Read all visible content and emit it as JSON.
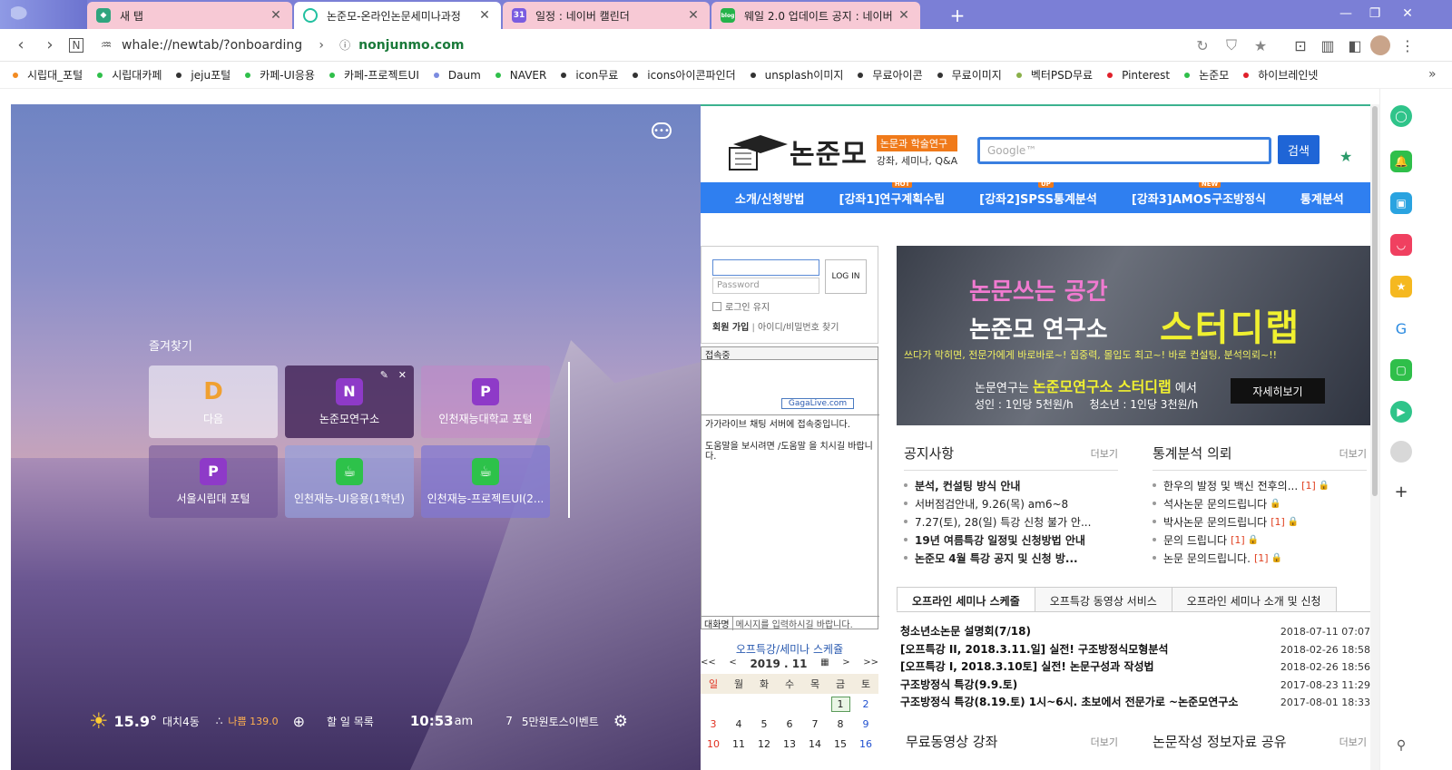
{
  "tabs": [
    {
      "title": "새 탭",
      "icon_color": "#2fa57e"
    },
    {
      "title": "논준모-온라인논문세미나과정",
      "icon_color": "#22c0a0"
    },
    {
      "title": "일정 : 네이버 캘린더",
      "icon_color": "#7a5ce0",
      "icon_text": "31"
    },
    {
      "title": "웨일 2.0 업데이트 공지 : 네이버",
      "icon_color": "#25b34a",
      "icon_text": "blog"
    }
  ],
  "address": {
    "url": "whale://newtab/?onboarding",
    "site": "nonjunmo.com"
  },
  "bookmarks": [
    {
      "label": "시립대_포털",
      "color": "#f28b22"
    },
    {
      "label": "시립대카페",
      "color": "#2fbf4a"
    },
    {
      "label": "jeju포털",
      "color": "#333333"
    },
    {
      "label": "카페-UI응용",
      "color": "#2fbf4a"
    },
    {
      "label": "카페-프로젝트UI",
      "color": "#2fbf4a"
    },
    {
      "label": "Daum",
      "color": "#7b8be0"
    },
    {
      "label": "NAVER",
      "color": "#2fbf4a"
    },
    {
      "label": "icon무료",
      "color": "#333333"
    },
    {
      "label": "icons아이콘파인더",
      "color": "#333333"
    },
    {
      "label": "unsplash이미지",
      "color": "#333333"
    },
    {
      "label": "무료아이콘",
      "color": "#333333"
    },
    {
      "label": "무료이미지",
      "color": "#333333"
    },
    {
      "label": "벡터PSD무료",
      "color": "#8ab04a"
    },
    {
      "label": "Pinterest",
      "color": "#e0202a"
    },
    {
      "label": "논준모",
      "color": "#2fbf4a"
    },
    {
      "label": "하이브레인넷",
      "color": "#e0202a"
    }
  ],
  "newtab": {
    "fav_title": "즐겨찾기",
    "tiles": [
      {
        "label": "다음",
        "icon": "D",
        "icon_color": "#f0a030"
      },
      {
        "label": "논준모연구소",
        "icon": "N",
        "icon_color": "#8e3ac8"
      },
      {
        "label": "인천재능대학교 포털",
        "icon": "P",
        "icon_color": "#8e3ac8"
      },
      {
        "label": "서울시립대 포털",
        "icon": "P",
        "icon_color": "#8e3ac8"
      },
      {
        "label": "인천재능-UI응용(1학년)",
        "icon": "☕",
        "icon_color": "#2dc24a"
      },
      {
        "label": "인천재능-프로젝트UI(2...",
        "icon": "☕",
        "icon_color": "#2dc24a"
      }
    ],
    "weather": {
      "temp": "15.9°",
      "location": "대치4동",
      "dust": "나쁨 139.0"
    },
    "todo": "할 일 목록",
    "time": "10:53",
    "ampm": "am",
    "event_count": "7",
    "event": "5만원토스이벤트"
  },
  "site": {
    "logo": "논준모",
    "tag1": "논문과 학술연구",
    "tag2": "강좌, 세미나, Q&A",
    "search_placeholder": "Google™",
    "search_btn": "검색",
    "menu": [
      {
        "label": "소개/신청방법",
        "badge": ""
      },
      {
        "label": "[강좌1]연구계획수립",
        "badge": "HOT"
      },
      {
        "label": "[강좌2]SPSS통계분석",
        "badge": "UP"
      },
      {
        "label": "[강좌3]AMOS구조방정식",
        "badge": "NEW"
      },
      {
        "label": "통계분석",
        "badge": ""
      }
    ],
    "login": {
      "pw_placeholder": "Password",
      "btn": "LOG IN",
      "keep": "로그인 유지",
      "join": "회원 가입",
      "find": "아이디/비밀번호 찾기"
    },
    "chat": {
      "title": "접속중",
      "brand": "GagaLive.com",
      "msg1": "가가라이브 채팅 서버에 접속중입니다.",
      "msg2": "도움말을 보시려면 /도움말 을 치시길 바랍니다.",
      "name_label": "대화명",
      "input_placeholder": "메시지를 입력하시길 바랍니다."
    },
    "banner": {
      "line1": "논문쓰는 공간",
      "line2": "논준모 연구소",
      "line3": "스터디랩",
      "line4": "쓰다가 막히면, 전문가에게 바로바로~! 집중력, 몰입도 최고~! 바로 컨설팅, 분석의뢰~!!",
      "line5": "논문연구는",
      "line6": "논준모연구소 스터디랩",
      "line7": "에서",
      "price1": "성인 : 1인당 5천원/h",
      "price2": "청소년 : 1인당 3천원/h",
      "btn": "자세히보기"
    },
    "notice": {
      "title": "공지사항",
      "more": "더보기",
      "items": [
        "분석, 컨설팅 방식 안내",
        "서버점검안내, 9.26(목) am6~8",
        "7.27(토), 28(일) 특강 신청 불가 안...",
        "19년 여름특강 일정및 신청방법 안내",
        "논준모 4월 특강 공지 및 신청 방..."
      ]
    },
    "stats": {
      "title": "통계분석 의뢰",
      "more": "더보기",
      "items": [
        {
          "t": "한우의 발정 및 백신 전후의...",
          "c": "[1]"
        },
        {
          "t": "석사논문 문의드립니다",
          "c": ""
        },
        {
          "t": "박사논문 문의드립니다",
          "c": "[1]"
        },
        {
          "t": "문의 드립니다",
          "c": "[1]"
        },
        {
          "t": "논문 문의드립니다.",
          "c": "[1]"
        }
      ]
    },
    "cal": {
      "title": "오프특강/세미나 스케쥴",
      "nav_prev2": "<<",
      "nav_prev": "<",
      "month": "2019 . 11",
      "nav_next": ">",
      "nav_next2": ">>",
      "days": [
        "일",
        "월",
        "화",
        "수",
        "목",
        "금",
        "토"
      ],
      "rows": [
        [
          "",
          "",
          "",
          "",
          "",
          "1",
          "2"
        ],
        [
          "3",
          "4",
          "5",
          "6",
          "7",
          "8",
          "9"
        ],
        [
          "10",
          "11",
          "12",
          "13",
          "14",
          "15",
          "16"
        ]
      ]
    },
    "sched_tabs": [
      "오프라인 세미나 스케줄",
      "오프특강 동영상 서비스",
      "오프라인 세미나 소개 및 신청"
    ],
    "sched": [
      {
        "t": "청소년소논문 설명회(7/18)",
        "d": "2018-07-11 07:07"
      },
      {
        "t": "[오프특강 II, 2018.3.11.일] 실전! 구조방정식모형분석",
        "d": "2018-02-26 18:58"
      },
      {
        "t": "[오프특강 I, 2018.3.10토] 실전! 논문구성과 작성법",
        "d": "2018-02-26 18:56"
      },
      {
        "t": "구조방정식 특강(9.9.토)",
        "d": "2017-08-23 11:29"
      },
      {
        "t": "구조방정식 특강(8.19.토) 1시~6시. 초보에서 전문가로 ~논준모연구소",
        "d": "2017-08-01 18:33"
      }
    ],
    "free": {
      "title": "무료동영상 강좌",
      "more": "더보기"
    },
    "share": {
      "title": "논문작성 정보자료 공유",
      "more": "더보기"
    }
  }
}
